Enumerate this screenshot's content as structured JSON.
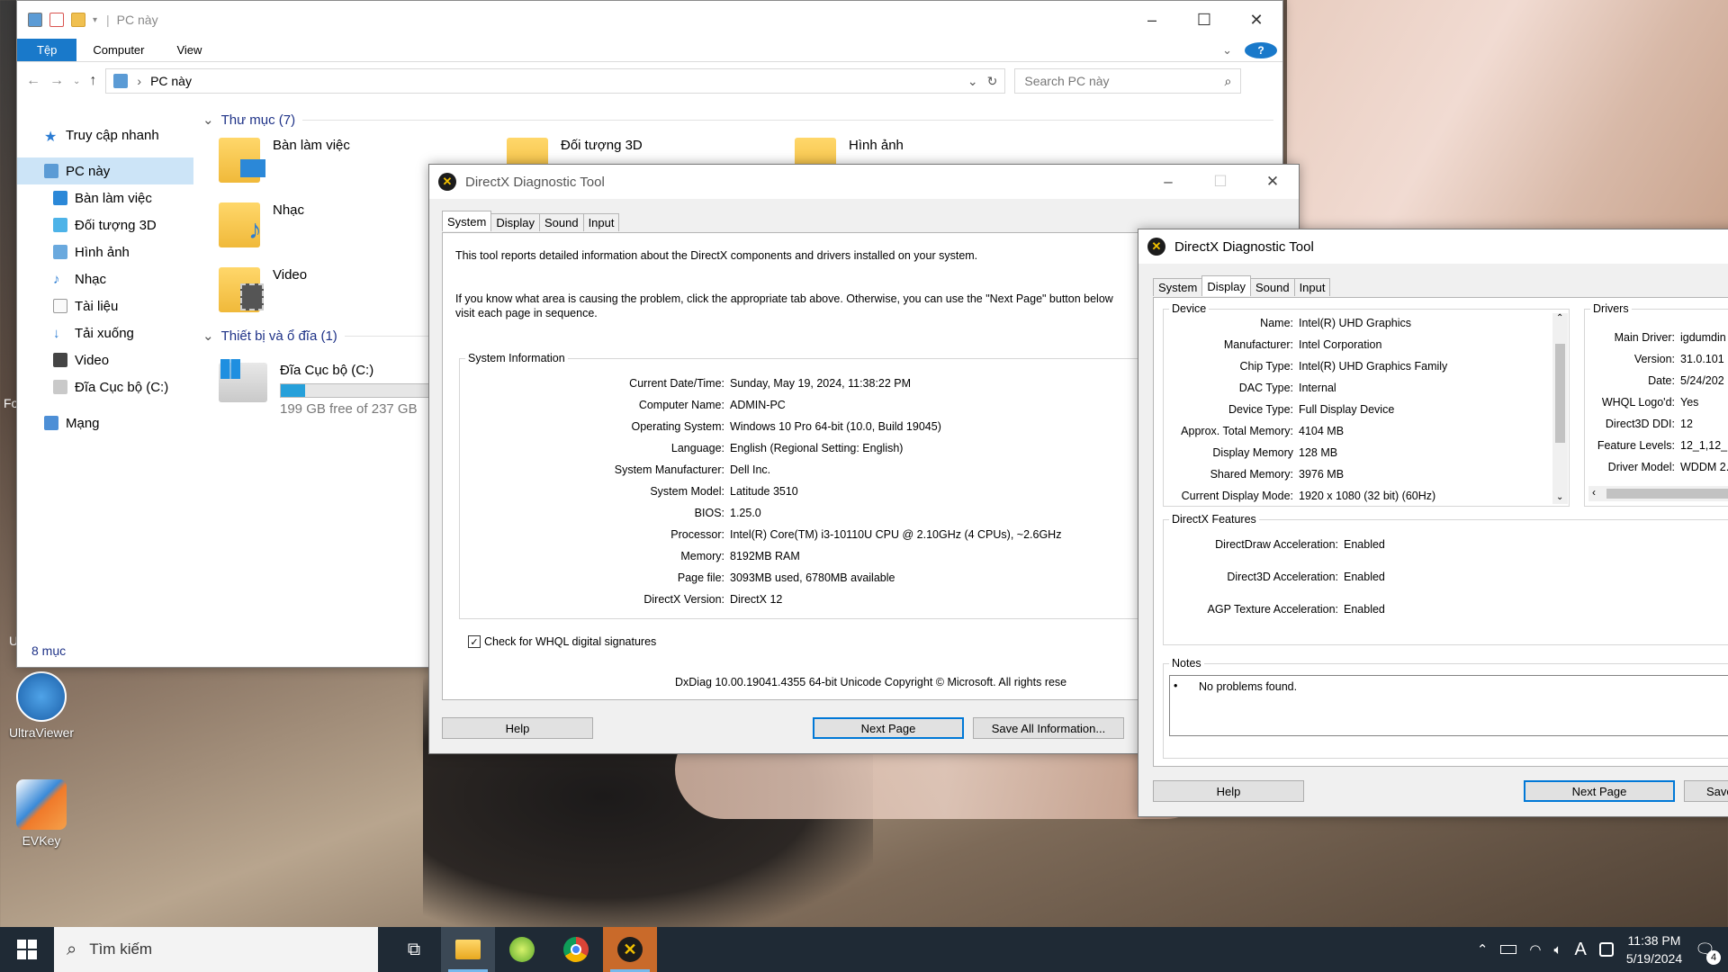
{
  "explorer": {
    "title": "PC này",
    "ribbon_tabs": [
      "Tệp",
      "Computer",
      "View"
    ],
    "address": "PC này",
    "search_placeholder": "Search PC này",
    "nav": [
      "Truy cập nhanh",
      "PC này",
      "Bàn làm việc",
      "Đối tượng 3D",
      "Hình ảnh",
      "Nhạc",
      "Tài liệu",
      "Tải xuống",
      "Video",
      "Đĩa Cục bộ (C:)",
      "Mạng"
    ],
    "folders_group": "Thư mục (7)",
    "folders": [
      "Bàn làm việc",
      "Đối tượng 3D",
      "Hình ảnh",
      "Nhạc",
      "Video"
    ],
    "devices_group": "Thiết bị và ổ đĩa (1)",
    "drive": {
      "name": "Đĩa Cục bộ (C:)",
      "free": "199 GB free of 237 GB",
      "used_fraction": 0.16
    },
    "status": "8 mục"
  },
  "dx1": {
    "title": "DirectX Diagnostic Tool",
    "tabs": [
      "System",
      "Display",
      "Sound",
      "Input"
    ],
    "intro1": "This tool reports detailed information about the DirectX components and drivers installed on your system.",
    "intro2": "If you know what area is causing the problem, click the appropriate tab above.  Otherwise, you can use the \"Next Page\" button below",
    "intro3": "visit each page in sequence.",
    "group_title": "System Information",
    "info": [
      {
        "k": "Current Date/Time:",
        "v": "Sunday, May 19, 2024, 11:38:22 PM"
      },
      {
        "k": "Computer Name:",
        "v": "ADMIN-PC"
      },
      {
        "k": "Operating System:",
        "v": "Windows 10 Pro 64-bit (10.0, Build 19045)"
      },
      {
        "k": "Language:",
        "v": "English (Regional Setting: English)"
      },
      {
        "k": "System Manufacturer:",
        "v": "Dell Inc."
      },
      {
        "k": "System Model:",
        "v": "Latitude 3510"
      },
      {
        "k": "BIOS:",
        "v": "1.25.0"
      },
      {
        "k": "Processor:",
        "v": "Intel(R) Core(TM) i3-10110U CPU @ 2.10GHz (4 CPUs), ~2.6GHz"
      },
      {
        "k": "Memory:",
        "v": "8192MB RAM"
      },
      {
        "k": "Page file:",
        "v": "3093MB used, 6780MB available"
      },
      {
        "k": "DirectX Version:",
        "v": "DirectX 12"
      }
    ],
    "whql": "Check for WHQL digital signatures",
    "footer": "DxDiag 10.00.19041.4355 64-bit Unicode  Copyright © Microsoft. All rights rese",
    "btn_help": "Help",
    "btn_next": "Next Page",
    "btn_save": "Save All Information..."
  },
  "dx2": {
    "title": "DirectX Diagnostic Tool",
    "tabs": [
      "System",
      "Display",
      "Sound",
      "Input"
    ],
    "device_title": "Device",
    "device": [
      {
        "k": "Name:",
        "v": "Intel(R) UHD Graphics"
      },
      {
        "k": "Manufacturer:",
        "v": "Intel Corporation"
      },
      {
        "k": "Chip Type:",
        "v": "Intel(R) UHD Graphics Family"
      },
      {
        "k": "DAC Type:",
        "v": "Internal"
      },
      {
        "k": "Device Type:",
        "v": "Full Display Device"
      },
      {
        "k": "Approx. Total Memory:",
        "v": "4104 MB"
      },
      {
        "k": "Display Memory",
        "v": "128 MB"
      },
      {
        "k": "Shared Memory:",
        "v": "3976 MB"
      },
      {
        "k": "Current Display Mode:",
        "v": "1920 x 1080 (32 bit) (60Hz)"
      }
    ],
    "drivers_title": "Drivers",
    "drivers": [
      {
        "k": "Main Driver:",
        "v": "igdumdin"
      },
      {
        "k": "Version:",
        "v": "31.0.101"
      },
      {
        "k": "Date:",
        "v": "5/24/202"
      },
      {
        "k": "WHQL Logo'd:",
        "v": "Yes"
      },
      {
        "k": "Direct3D DDI:",
        "v": "12"
      },
      {
        "k": "Feature Levels:",
        "v": "12_1,12_"
      },
      {
        "k": "Driver Model:",
        "v": "WDDM 2."
      }
    ],
    "features_title": "DirectX Features",
    "features": [
      {
        "k": "DirectDraw Acceleration:",
        "v": "Enabled"
      },
      {
        "k": "Direct3D Acceleration:",
        "v": "Enabled"
      },
      {
        "k": "AGP Texture Acceleration:",
        "v": "Enabled"
      }
    ],
    "notes_title": "Notes",
    "note": "No problems found.",
    "btn_help": "Help",
    "btn_next": "Next Page",
    "btn_save": "Save"
  },
  "desktop": {
    "icons": [
      "UltraViewer",
      "EVKey"
    ],
    "edge_text": [
      "Fo",
      "U"
    ]
  },
  "taskbar": {
    "search": "Tìm kiếm",
    "time": "11:38 PM",
    "date": "5/19/2024",
    "notif_count": "4",
    "ime": "A"
  }
}
